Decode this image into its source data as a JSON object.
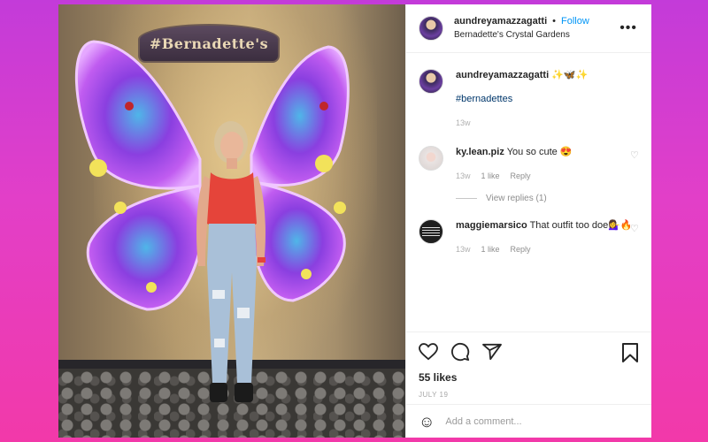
{
  "post": {
    "photo_sign": "#Bernadette's",
    "author": "aundreyamazzagatti",
    "separator": "•",
    "follow_label": "Follow",
    "location": "Bernadette's Crystal Gardens",
    "more_icon": "more-horizontal-icon"
  },
  "caption": {
    "author": "aundreyamazzagatti",
    "text": "✨🦋✨",
    "hashtag": "#bernadettes",
    "age": "13w"
  },
  "comments": [
    {
      "author": "ky.lean.piz",
      "text": "You so cute 😍",
      "age": "13w",
      "likes": "1 like",
      "reply_label": "Reply",
      "view_replies": "View replies (1)"
    },
    {
      "author": "maggiemarsico",
      "text": "That outfit too doe💁‍♀️🔥",
      "age": "13w",
      "likes": "1 like",
      "reply_label": "Reply"
    }
  ],
  "actions": {
    "icons": [
      "heart-icon",
      "comment-icon",
      "share-icon",
      "bookmark-icon"
    ],
    "likes": "55 likes",
    "date": "JULY 19"
  },
  "add_comment": {
    "placeholder": "Add a comment..."
  },
  "colors": {
    "follow": "#0095f6",
    "hashtag": "#00376b",
    "background_top": "#c33bd9",
    "background_bottom": "#f239a9"
  }
}
